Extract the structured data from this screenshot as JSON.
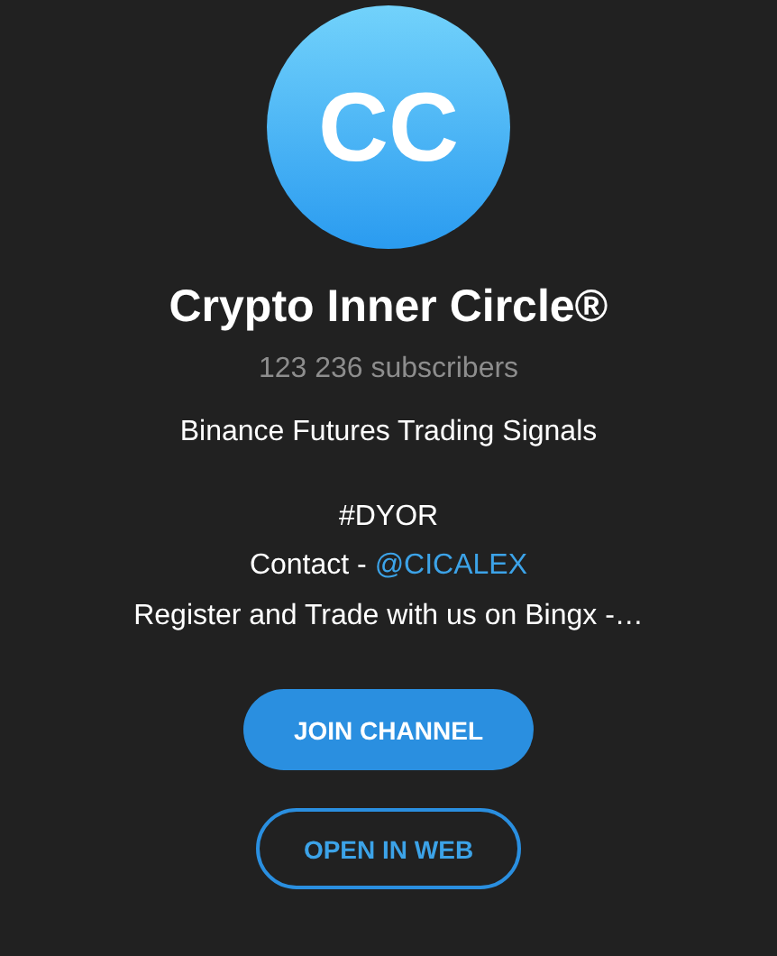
{
  "channel": {
    "avatar_initials": "CC",
    "title": "Crypto Inner Circle®",
    "subscribers": "123 236 subscribers"
  },
  "description": [
    {
      "lines": [
        {
          "kind": "text",
          "text": "Binance Futures Trading Signals"
        }
      ]
    },
    {
      "lines": [
        {
          "kind": "text",
          "text": "#DYOR"
        },
        {
          "kind": "contact",
          "text": "Contact - ",
          "link": "@CICALEX"
        },
        {
          "kind": "text",
          "text": "Register and Trade with us on Bingx -…"
        }
      ]
    }
  ],
  "buttons": [
    {
      "kind": "primary",
      "label": "JOIN CHANNEL"
    },
    {
      "kind": "outline",
      "label": "OPEN IN WEB"
    }
  ]
}
